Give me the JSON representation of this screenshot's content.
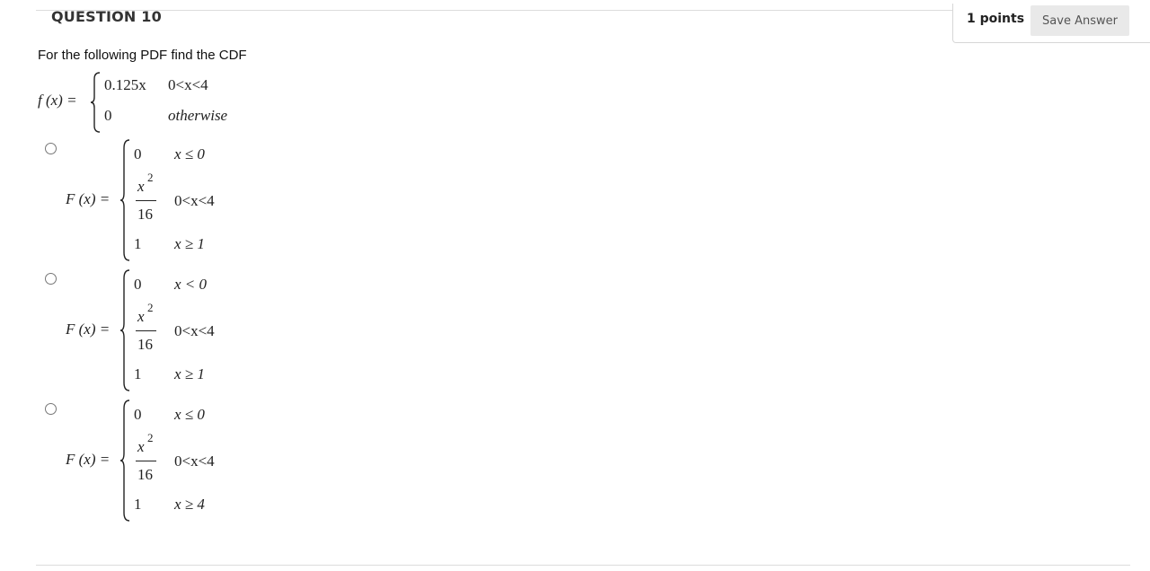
{
  "question": {
    "title": "QUESTION 10",
    "points": "1 points",
    "save_label": "Save Answer",
    "prompt": "For the following PDF find the CDF"
  },
  "pdf": {
    "lhs": "f (x) =",
    "case1_value": "0.125x",
    "case1_condition": "0<x<4",
    "case2_value": "0",
    "case2_condition": "otherwise"
  },
  "options": [
    {
      "lhs": "F (x) =",
      "case1_value": "0",
      "case1_condition": "x ≤ 0",
      "case2_num": "x",
      "case2_exp": "2",
      "case2_den": "16",
      "case2_condition": "0<x<4",
      "case3_value": "1",
      "case3_condition": "x ≥ 1"
    },
    {
      "lhs": "F (x) =",
      "case1_value": "0",
      "case1_condition": "x < 0",
      "case2_num": "x",
      "case2_exp": "2",
      "case2_den": "16",
      "case2_condition": "0<x<4",
      "case3_value": "1",
      "case3_condition": "x ≥ 1"
    },
    {
      "lhs": "F (x) =",
      "case1_value": "0",
      "case1_condition": "x ≤ 0",
      "case2_num": "x",
      "case2_exp": "2",
      "case2_den": "16",
      "case2_condition": "0<x<4",
      "case3_value": "1",
      "case3_condition": "x ≥ 4"
    }
  ]
}
